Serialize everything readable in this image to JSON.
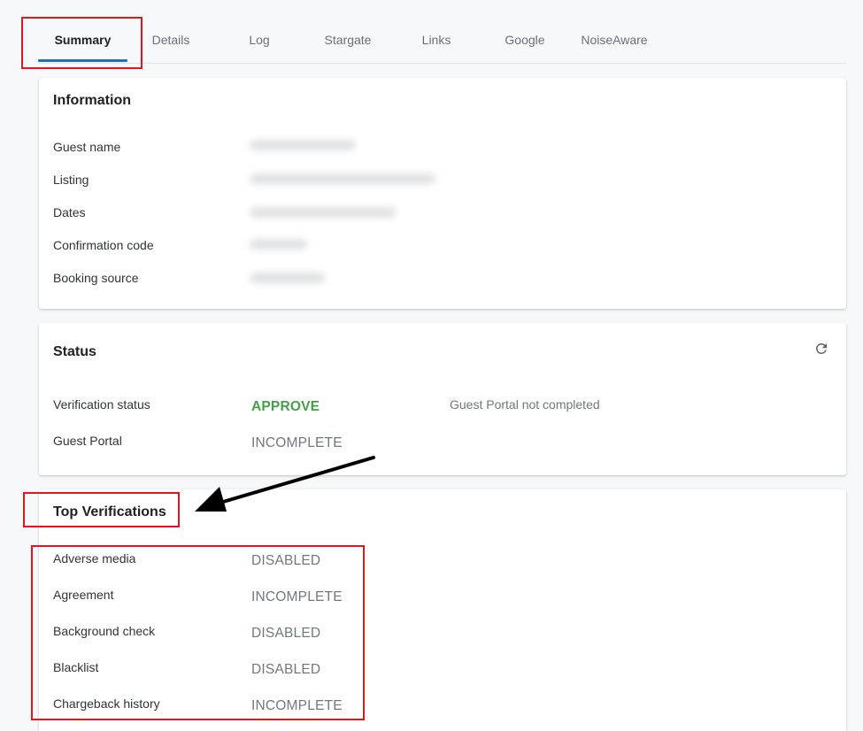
{
  "tabs": [
    {
      "label": "Summary",
      "active": true
    },
    {
      "label": "Details"
    },
    {
      "label": "Log"
    },
    {
      "label": "Stargate"
    },
    {
      "label": "Links"
    },
    {
      "label": "Google"
    },
    {
      "label": "NoiseAware"
    }
  ],
  "information": {
    "title": "Information",
    "rows": [
      {
        "label": "Guest name"
      },
      {
        "label": "Listing"
      },
      {
        "label": "Dates"
      },
      {
        "label": "Confirmation code"
      },
      {
        "label": "Booking source"
      }
    ]
  },
  "status": {
    "title": "Status",
    "refresh_icon": "refresh-icon",
    "rows": [
      {
        "label": "Verification status",
        "value": "APPROVE",
        "note": "Guest Portal not completed"
      },
      {
        "label": "Guest Portal",
        "value": "INCOMPLETE"
      }
    ]
  },
  "top_verifications": {
    "title": "Top Verifications",
    "rows": [
      {
        "label": "Adverse media",
        "value": "DISABLED"
      },
      {
        "label": "Agreement",
        "value": "INCOMPLETE"
      },
      {
        "label": "Background check",
        "value": "DISABLED"
      },
      {
        "label": "Blacklist",
        "value": "DISABLED"
      },
      {
        "label": "Chargeback history",
        "value": "INCOMPLETE"
      }
    ]
  },
  "colors": {
    "accent": "#1f6fbf",
    "approve": "#43a047",
    "annotation": "#e8141c"
  }
}
